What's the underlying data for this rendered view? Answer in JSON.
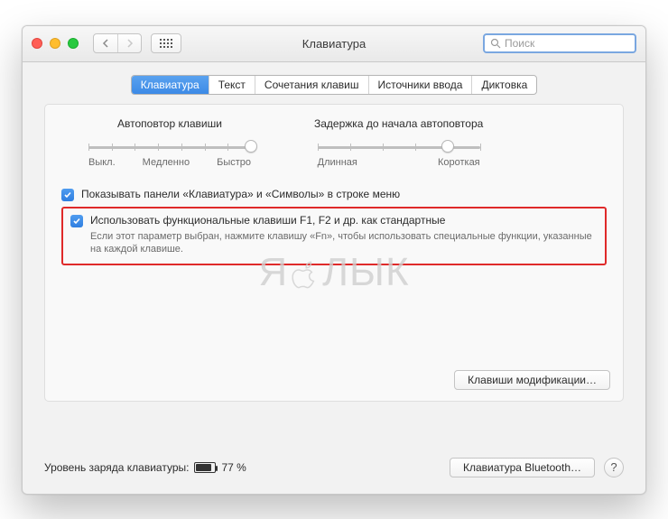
{
  "window": {
    "title": "Клавиатура"
  },
  "search": {
    "placeholder": "Поиск"
  },
  "tabs": [
    {
      "label": "Клавиатура",
      "active": true
    },
    {
      "label": "Текст",
      "active": false
    },
    {
      "label": "Сочетания клавиш",
      "active": false
    },
    {
      "label": "Источники ввода",
      "active": false
    },
    {
      "label": "Диктовка",
      "active": false
    }
  ],
  "sliders": {
    "repeat": {
      "title": "Автоповтор клавиши",
      "left": "Выкл.",
      "mid": "Медленно",
      "right": "Быстро",
      "ticks": 8,
      "value_index": 7
    },
    "delay": {
      "title": "Задержка до начала автоповтора",
      "left": "Длинная",
      "right": "Короткая",
      "ticks": 6,
      "value_index": 4
    }
  },
  "checkboxes": {
    "show_panels": {
      "checked": true,
      "label": "Показывать панели «Клавиатура» и «Символы» в строке меню"
    },
    "fn_keys": {
      "checked": true,
      "label": "Использовать функциональные клавиши F1, F2 и др. как стандартные",
      "help": "Если этот параметр выбран, нажмите клавишу «Fn», чтобы использовать специальные функции, указанные на каждой клавише."
    }
  },
  "buttons": {
    "modifier_keys": "Клавиши модификации…",
    "bluetooth": "Клавиатура Bluetooth…"
  },
  "battery": {
    "label": "Уровень заряда клавиатуры:",
    "percent_text": "77 %",
    "percent_value": 77
  },
  "watermark": {
    "left": "Я",
    "right": "ЛЫК"
  }
}
